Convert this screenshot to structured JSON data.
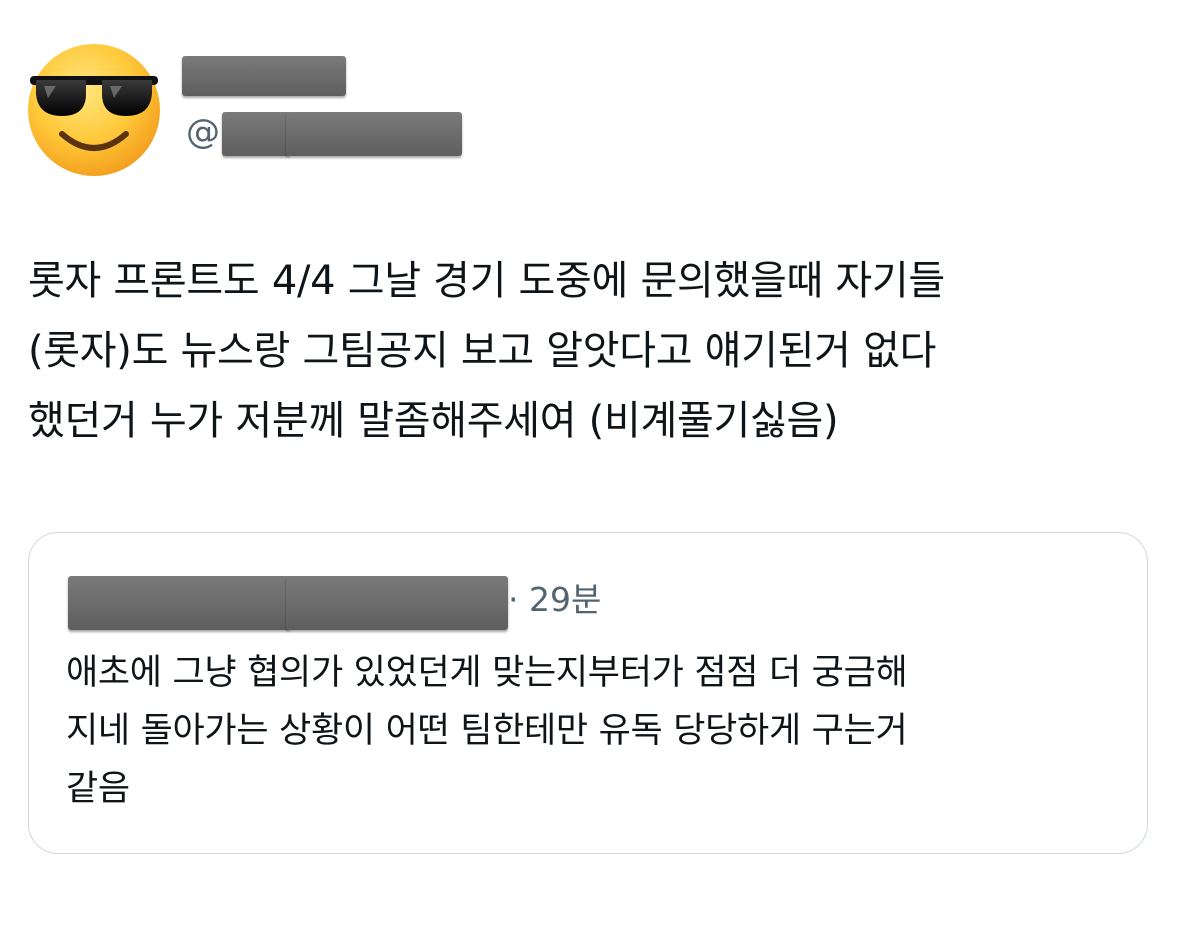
{
  "author": {
    "avatar_icon": "sunglasses-emoji-icon",
    "handle_prefix": "@"
  },
  "tweet": {
    "lines": [
      "롯자 프론트도 4/4 그날 경기 도중에 문의했을때 자기들",
      "(롯자)도 뉴스랑 그팀공지 보고 알앗다고 얘기된거 없다",
      "했던거 누가 저분께 말좀해주세여 (비계풀기싫음)"
    ]
  },
  "quote": {
    "time": "· 29분",
    "lines": [
      "애초에 그냥 협의가 있었던게 맞는지부터가 점점 더 궁금해",
      "지네 돌아가는 상황이 어떤 팀한테만 유독 당당하게 구는거",
      "같음"
    ]
  },
  "colors": {
    "text_primary": "#0f1419",
    "text_secondary": "#536471",
    "card_border": "#cfd9de",
    "redaction": "#6b6b6b"
  }
}
